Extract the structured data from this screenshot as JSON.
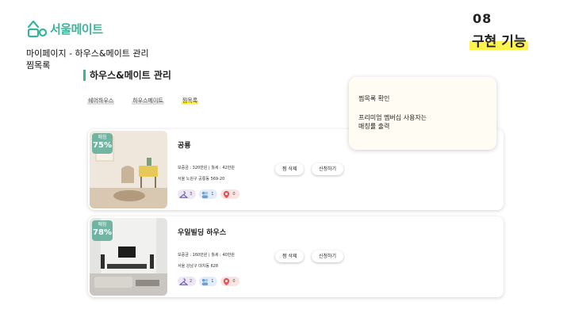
{
  "brand": {
    "name": "서울메이트",
    "color": "#3bb39a"
  },
  "slide": {
    "number": "08",
    "title": "구현 기능"
  },
  "breadcrumb": {
    "line1": "마이페이지 - 하우스&메이트 관리",
    "line2": "찜목록"
  },
  "section": {
    "title": "하우스&메이트 관리"
  },
  "tabs": [
    {
      "label": "쉐어하우스",
      "active": false
    },
    {
      "label": "하우스메이트",
      "active": false
    },
    {
      "label": "찜목록",
      "active": true
    }
  ],
  "cards": [
    {
      "badge_label": "매칭",
      "badge_value": "75%",
      "name": "공룡",
      "price": "보증금 : 320만원 | 월세 : 42만원",
      "address": "서울 노원구 공릉동 569-20",
      "delete_label": "찜 삭제",
      "apply_label": "신청하기",
      "stats": [
        "3",
        "1",
        "0"
      ]
    },
    {
      "badge_label": "매칭",
      "badge_value": "78%",
      "name": "우일빌딩 하우스",
      "price": "보증금 : 160만원 | 월세 : 40만원",
      "address": "서울 강남구 대치동 628",
      "delete_label": "찜 삭제",
      "apply_label": "신청하기",
      "stats": [
        "2",
        "1",
        "0"
      ]
    }
  ],
  "tooltip": {
    "line1": "찜목록 확인",
    "line2": "프리미엄 멤버십 사용자는",
    "line3": "매칭률 출력"
  },
  "icons": {
    "stat1": "hanger-icon",
    "stat2": "people-icon",
    "stat3": "location-pin-icon"
  }
}
